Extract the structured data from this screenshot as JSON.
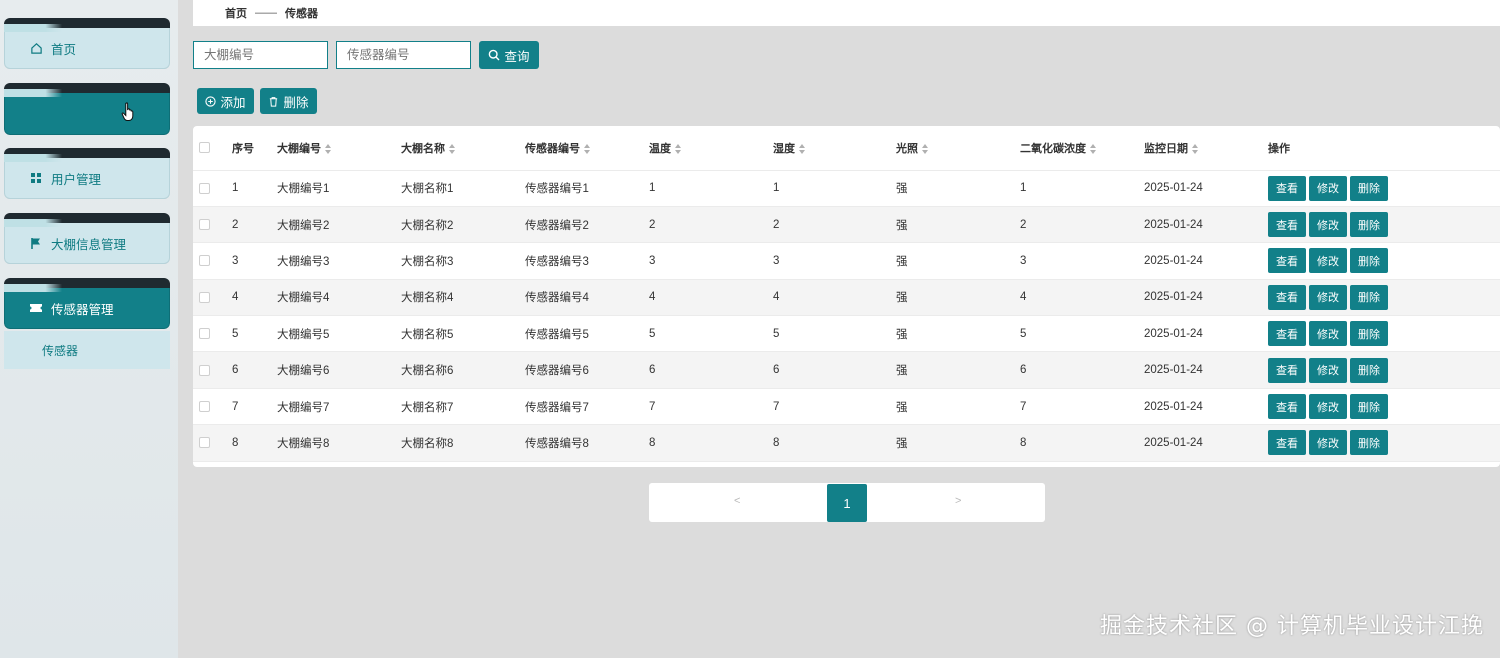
{
  "sidebar": {
    "items": [
      {
        "label": "首页",
        "icon": "home-icon",
        "active": false
      },
      {
        "label": "",
        "icon": "",
        "active": true
      },
      {
        "label": "用户管理",
        "icon": "grid-icon",
        "active": false
      },
      {
        "label": "大棚信息管理",
        "icon": "flag-icon",
        "active": false
      },
      {
        "label": "传感器管理",
        "icon": "ticket-icon",
        "active": true
      }
    ],
    "submenu": {
      "label": "传感器"
    }
  },
  "breadcrumb": {
    "home": "首页",
    "separator": "——",
    "current": "传感器"
  },
  "search": {
    "greenhouse_placeholder": "大棚编号",
    "sensor_placeholder": "传感器编号",
    "query_label": "查询"
  },
  "toolbar": {
    "add_label": "添加",
    "delete_label": "删除"
  },
  "table": {
    "headers": [
      "序号",
      "大棚编号",
      "大棚名称",
      "传感器编号",
      "温度",
      "湿度",
      "光照",
      "二氧化碳浓度",
      "监控日期",
      "操作"
    ],
    "rows": [
      {
        "index": "1",
        "gh_code": "大棚编号1",
        "gh_name": "大棚名称1",
        "sensor_code": "传感器编号1",
        "temp": "1",
        "humidity": "1",
        "light": "强",
        "co2": "1",
        "date": "2025-01-24"
      },
      {
        "index": "2",
        "gh_code": "大棚编号2",
        "gh_name": "大棚名称2",
        "sensor_code": "传感器编号2",
        "temp": "2",
        "humidity": "2",
        "light": "强",
        "co2": "2",
        "date": "2025-01-24"
      },
      {
        "index": "3",
        "gh_code": "大棚编号3",
        "gh_name": "大棚名称3",
        "sensor_code": "传感器编号3",
        "temp": "3",
        "humidity": "3",
        "light": "强",
        "co2": "3",
        "date": "2025-01-24"
      },
      {
        "index": "4",
        "gh_code": "大棚编号4",
        "gh_name": "大棚名称4",
        "sensor_code": "传感器编号4",
        "temp": "4",
        "humidity": "4",
        "light": "强",
        "co2": "4",
        "date": "2025-01-24"
      },
      {
        "index": "5",
        "gh_code": "大棚编号5",
        "gh_name": "大棚名称5",
        "sensor_code": "传感器编号5",
        "temp": "5",
        "humidity": "5",
        "light": "强",
        "co2": "5",
        "date": "2025-01-24"
      },
      {
        "index": "6",
        "gh_code": "大棚编号6",
        "gh_name": "大棚名称6",
        "sensor_code": "传感器编号6",
        "temp": "6",
        "humidity": "6",
        "light": "强",
        "co2": "6",
        "date": "2025-01-24"
      },
      {
        "index": "7",
        "gh_code": "大棚编号7",
        "gh_name": "大棚名称7",
        "sensor_code": "传感器编号7",
        "temp": "7",
        "humidity": "7",
        "light": "强",
        "co2": "7",
        "date": "2025-01-24"
      },
      {
        "index": "8",
        "gh_code": "大棚编号8",
        "gh_name": "大棚名称8",
        "sensor_code": "传感器编号8",
        "temp": "8",
        "humidity": "8",
        "light": "强",
        "co2": "8",
        "date": "2025-01-24"
      }
    ],
    "actions": {
      "view": "查看",
      "edit": "修改",
      "delete": "删除"
    }
  },
  "pagination": {
    "prev": "<",
    "current": "1",
    "next": ">"
  },
  "watermark": "掘金技术社区 @ 计算机毕业设计江挽",
  "colors": {
    "accent": "#128089",
    "sidebar_item": "#cfe6ec",
    "dark_strip": "#1f2a30"
  }
}
